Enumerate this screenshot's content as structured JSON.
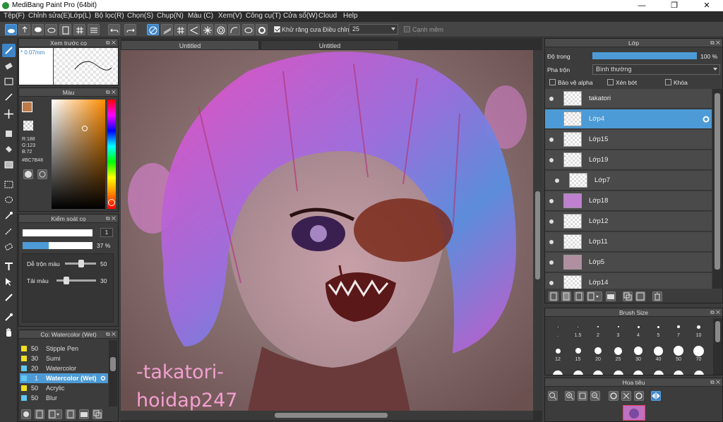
{
  "window": {
    "title": "MediBang Paint Pro (64bit)",
    "min": "—",
    "max": "❐",
    "close": "✕"
  },
  "menu": [
    "Tệp(F)",
    "Chỉnh sửa(E)",
    "Lớp(L)",
    "Bộ lọc(R)",
    "Chọn(S)",
    "Chụp(N)",
    "Màu (C)",
    "Xem(V)",
    "Công cụ(T)",
    "Cửa sổ(W)",
    "Cloud",
    "Help"
  ],
  "toolbar": {
    "antialias_label": "Khử răng cưa",
    "adjust_label": "Điều chỉnh",
    "adjust_value": "25",
    "smooth_edge_label": "Cạnh mềm"
  },
  "preview": {
    "title": "Xem trước cọ",
    "size": "* 0.07mm"
  },
  "color": {
    "title": "Màu",
    "r": "R:188",
    "g": "G:123",
    "b": "B:72",
    "hex": "#BC7B48",
    "main_color": "#BC7B48"
  },
  "brush_control": {
    "title": "Kiểm soát cọ",
    "size": "1",
    "opacity": "37",
    "opacity_unit": "%",
    "opacity_fraction": 0.37,
    "mix_label": "Dễ trộn màu",
    "mix_value": "50",
    "reload_label": "Tải màu",
    "reload_value": "30"
  },
  "brushes": {
    "title": "Cọ: Watercolor (Wet)",
    "items": [
      {
        "size": "50",
        "name": "Stipple Pen",
        "color": "#f0e020"
      },
      {
        "size": "30",
        "name": "Sumi",
        "color": "#f0e020"
      },
      {
        "size": "20",
        "name": "Watercolor",
        "color": "#60c8f0"
      },
      {
        "size": "1",
        "name": "Watercolor (Wet)",
        "color": "#60c8f0"
      },
      {
        "size": "50",
        "name": "Acrylic",
        "color": "#f0e020"
      },
      {
        "size": "50",
        "name": "Blur",
        "color": "#60c8f0"
      }
    ]
  },
  "canvas": {
    "tab1": "Untitled",
    "tab2": "Untitled",
    "watermark1": "-takatori-",
    "watermark2": "hoidap247"
  },
  "layers": {
    "title": "Lớp",
    "opacity_label": "Độ trong",
    "opacity_value": "100",
    "opacity_unit": "%",
    "opacity_fraction": 1.0,
    "blend_label": "Pha trộn",
    "blend_value": "Bình thường",
    "protect_alpha": "Bảo vệ alpha",
    "clip": "Xén bớt",
    "lock": "Khóa",
    "items": [
      "takatori",
      "Lớp4",
      "Lớp15",
      "Lớp19",
      "Lớp7",
      "Lớp18",
      "Lớp12",
      "Lớp11",
      "Lớp5",
      "Lớp14"
    ]
  },
  "brush_size": {
    "title": "Brush Size",
    "row1": [
      ".",
      "1.5",
      "2",
      "3",
      "4",
      "5",
      "7",
      "10"
    ],
    "row2": [
      "12",
      "15",
      "20",
      "25",
      "30",
      "40",
      "50",
      "70"
    ]
  },
  "navigator": {
    "title": "Hoa tiêu"
  }
}
